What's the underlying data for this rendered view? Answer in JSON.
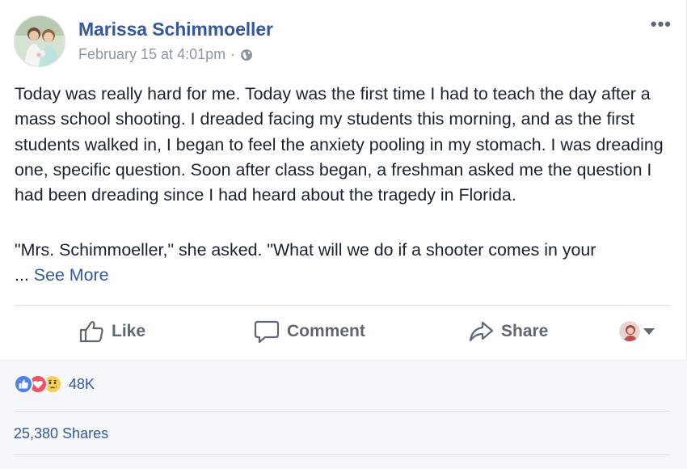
{
  "post": {
    "author": "Marissa Schimmoeller",
    "timestamp": "February 15 at 4:01pm",
    "separator": "·",
    "privacy_icon": "globe-icon",
    "more_icon": "•••",
    "paragraph1": "Today was really hard for me. Today was the first time I had to teach the day after a mass school shooting. I dreaded facing my students this morning, and as the first students walked in, I began to feel the anxiety pooling in my stomach. I was dreading one, specific question. Soon after class began, a freshman asked me the question I had been dreading since I had heard about the tragedy in Florida.",
    "paragraph2": "\"Mrs. Schimmoeller,\" she asked. \"What will we do if a shooter comes in your",
    "ellipsis": "...",
    "see_more": "See More"
  },
  "actions": {
    "like": "Like",
    "comment": "Comment",
    "share": "Share"
  },
  "stats": {
    "reactions": [
      "like",
      "love",
      "sad"
    ],
    "reaction_count": "48K",
    "shares": "25,380 Shares"
  },
  "colors": {
    "link": "#365899",
    "meta": "#90949c",
    "action": "#606770",
    "like": "#4e81ee",
    "love": "#f25268",
    "sad": "#f7d055"
  }
}
